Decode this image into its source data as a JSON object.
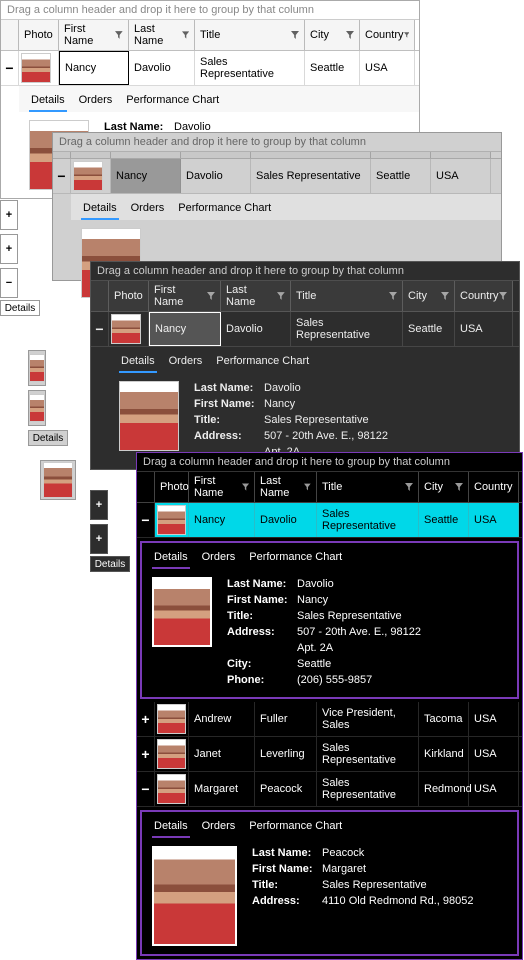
{
  "groupbar_text": "Drag a column header and drop it here to group by that column",
  "columns": {
    "photo": "Photo",
    "first_name": "First Name",
    "last_name": "Last Name",
    "title": "Title",
    "city": "City",
    "country": "Country"
  },
  "tabs": {
    "details": "Details",
    "orders": "Orders",
    "perf": "Performance Chart"
  },
  "labels": {
    "last_name": "Last Name:",
    "first_name": "First Name:",
    "title": "Title:",
    "address": "Address:",
    "city": "City:",
    "phone": "Phone:"
  },
  "rows": {
    "nancy": {
      "first_name": "Nancy",
      "last_name": "Davolio",
      "title": "Sales Representative",
      "city": "Seattle",
      "country": "USA",
      "address_l1": "507 - 20th Ave. E., 98122",
      "address_l2": "Apt. 2A",
      "phone": "(206) 555-9857"
    },
    "andrew": {
      "first_name": "Andrew",
      "last_name": "Fuller",
      "title": "Vice President, Sales",
      "city": "Tacoma",
      "country": "USA"
    },
    "janet": {
      "first_name": "Janet",
      "last_name": "Leverling",
      "title": "Sales Representative",
      "city": "Kirkland",
      "country": "USA"
    },
    "margaret": {
      "first_name": "Margaret",
      "last_name": "Peacock",
      "title": "Sales Representative",
      "city": "Redmond",
      "country": "USA",
      "address": "4110 Old Redmond Rd., 98052"
    }
  },
  "expand": {
    "plus": "+",
    "minus": "−"
  }
}
